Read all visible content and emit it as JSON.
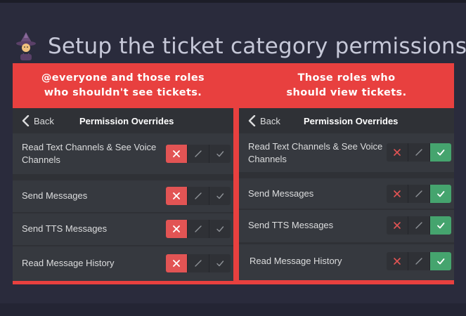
{
  "title": {
    "emoji_icon": "mage-emoji-icon",
    "text": "Setup the ticket category permissions:"
  },
  "colors": {
    "background": "#2a2b3c",
    "header_red": "#e8403f",
    "deny_red": "#e25454",
    "allow_green": "#45a46e",
    "panel_gray": "#36393f",
    "navbar_gray": "#2f3136"
  },
  "panels": {
    "left": {
      "header": "@everyone and those roles\nwho shouldn't see tickets.",
      "back_label": "Back",
      "nav_title": "Permission Overrides",
      "rows": [
        {
          "label": "Read Text Channels & See Voice Channels",
          "state": "deny"
        },
        {
          "label": "Send Messages",
          "state": "deny"
        },
        {
          "label": "Send TTS Messages",
          "state": "deny"
        },
        {
          "label": "Read Message History",
          "state": "deny"
        }
      ]
    },
    "right": {
      "header": "Those roles who\nshould view tickets.",
      "back_label": "Back",
      "nav_title": "Permission Overrides",
      "rows": [
        {
          "label": "Read Text Channels & See Voice Channels",
          "state": "allow"
        },
        {
          "label": "Send Messages",
          "state": "allow"
        },
        {
          "label": "Send TTS Messages",
          "state": "allow"
        },
        {
          "label": "Read Message History",
          "state": "allow"
        }
      ]
    }
  }
}
